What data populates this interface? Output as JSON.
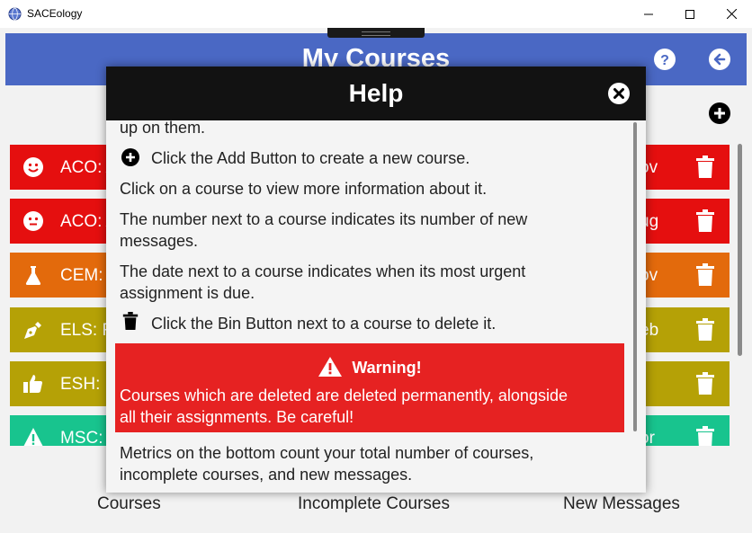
{
  "window": {
    "title": "SACEology"
  },
  "header": {
    "title": "My Courses",
    "help_icon": "help-icon",
    "back_icon": "back-icon",
    "color": "#4a68c4"
  },
  "courses": [
    {
      "label": "ACO: A",
      "date": "ov",
      "icon": "smile-icon",
      "color": "#e50f0f"
    },
    {
      "label": "ACO: A",
      "date": "ug",
      "icon": "neutral-face-icon",
      "color": "#e50f0f"
    },
    {
      "label": "CEM:",
      "date": "ov",
      "icon": "flask-icon",
      "color": "#e36a0c"
    },
    {
      "label": "ELS: F",
      "date": "eb",
      "icon": "pen-icon",
      "color": "#b5a106"
    },
    {
      "label": "ESH: F",
      "date": "",
      "icon": "thumbs-up-icon",
      "color": "#b5a106"
    },
    {
      "label": "MSC:",
      "date": "or",
      "icon": "warning-icon",
      "color": "#18c48e"
    }
  ],
  "metrics": {
    "courses": "Courses",
    "incomplete": "Incomplete Courses",
    "new_messages": "New Messages"
  },
  "help": {
    "title": "Help",
    "line_cut": "up on them.",
    "add": "Click the Add Button to create a new course.",
    "click_course": "Click on a course to view more information about it.",
    "number_1": "The number next to a course indicates its number of new",
    "number_2": "messages.",
    "date_1": "The date next to a course indicates when its most urgent",
    "date_2": "assignment is due.",
    "bin": "Click the Bin Button next to a course to delete it.",
    "warning_title": "Warning!",
    "warning_1": "Courses which are deleted are deleted permanently, alongside",
    "warning_2": "all their assignments. Be careful!",
    "metrics_1": "Metrics on the bottom count your total number of courses,",
    "metrics_2": "incomplete courses, and new messages."
  }
}
